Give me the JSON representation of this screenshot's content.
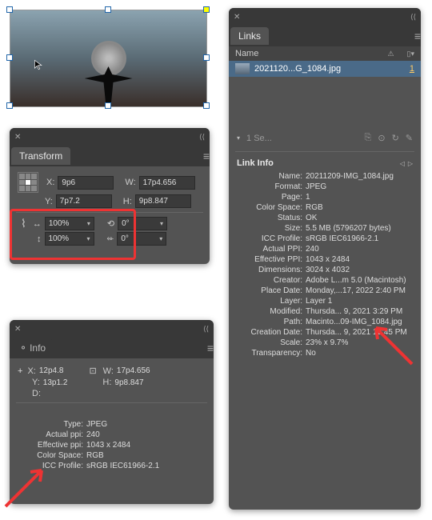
{
  "image_filename": "20211209-IMG_1084.jpg",
  "transform": {
    "title": "Transform",
    "x_label": "X:",
    "x": "9p6",
    "y_label": "Y:",
    "y": "7p7.2",
    "w_label": "W:",
    "w": "17p4.656",
    "h_label": "H:",
    "h": "9p8.847",
    "scale_x": "100%",
    "scale_y": "100%",
    "rotate": "0°",
    "shear": "0°"
  },
  "info": {
    "title": "Info",
    "x_label": "X:",
    "x": "12p4.8",
    "y_label": "Y:",
    "y": "13p1.2",
    "d_label": "D:",
    "w_label": "W:",
    "w": "17p4.656",
    "h_label": "H:",
    "h": "9p8.847",
    "type_label": "Type:",
    "type": "JPEG",
    "appi_label": "Actual ppi:",
    "appi": "240",
    "eppi_label": "Effective ppi:",
    "eppi": "1043 x 2484",
    "cs_label": "Color Space:",
    "cs": "RGB",
    "icc_label": "ICC Profile:",
    "icc": "sRGB IEC61966-2.1"
  },
  "links": {
    "title": "Links",
    "name_col": "Name",
    "file_display": "2021120...G_1084.jpg",
    "file_page": "1",
    "selected": "1 Se...",
    "info_title": "Link Info",
    "name_label": "Name:",
    "name": "20211209-IMG_1084.jpg",
    "format_label": "Format:",
    "format": "JPEG",
    "page_label": "Page:",
    "page": "1",
    "cs_label": "Color Space:",
    "cs": "RGB",
    "status_label": "Status:",
    "status": "OK",
    "size_label": "Size:",
    "size": "5.5 MB (5796207 bytes)",
    "icc_label": "ICC Profile:",
    "icc": "sRGB IEC61966-2.1",
    "appi_label": "Actual PPI:",
    "appi": "240",
    "eppi_label": "Effective PPI:",
    "eppi": "1043 x 2484",
    "dim_label": "Dimensions:",
    "dim": "3024 x 4032",
    "creator_label": "Creator:",
    "creator": "Adobe L...m 5.0 (Macintosh)",
    "place_label": "Place Date:",
    "place": "Monday,...17, 2022 2:40 PM",
    "layer_label": "Layer:",
    "layer": "Layer 1",
    "mod_label": "Modified:",
    "mod": "Thursda... 9, 2021 3:29 PM",
    "path_label": "Path:",
    "path": "Macinto...09-IMG_1084.jpg",
    "created_label": "Creation Date:",
    "created": "Thursda... 9, 2021 12:45 PM",
    "scale_label": "Scale:",
    "scale": "23% x 9.7%",
    "trans_label": "Transparency:",
    "trans": "No"
  }
}
